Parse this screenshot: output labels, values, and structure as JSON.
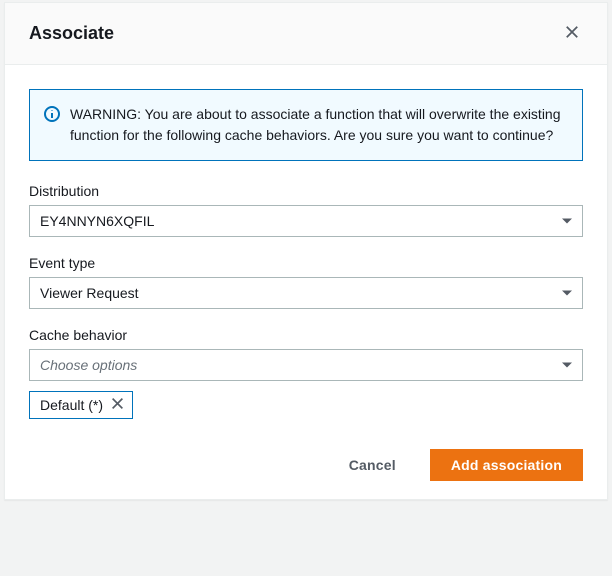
{
  "modal": {
    "title": "Associate",
    "alert": "WARNING: You are about to associate a function that will overwrite the existing function for the following cache behaviors. Are you sure you want to continue?",
    "distribution": {
      "label": "Distribution",
      "value": "EY4NNYN6XQFIL"
    },
    "event_type": {
      "label": "Event type",
      "value": "Viewer Request"
    },
    "cache_behavior": {
      "label": "Cache behavior",
      "placeholder": "Choose options",
      "selected_token": "Default (*)"
    },
    "footer": {
      "cancel": "Cancel",
      "submit": "Add association"
    }
  }
}
